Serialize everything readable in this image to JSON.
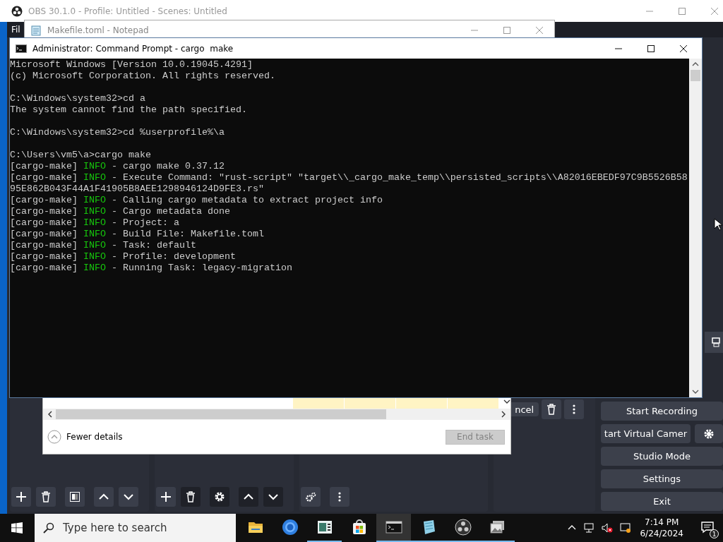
{
  "obs": {
    "title": "OBS 30.1.0 - Profile: Untitled - Scenes: Untitled",
    "menu": [
      "Fil"
    ],
    "dock_button": "ncel",
    "controls": [
      {
        "label": "Start Recording",
        "settings": false
      },
      {
        "label": "tart Virtual Camer",
        "settings": true
      },
      {
        "label": "Studio Mode",
        "settings": false
      },
      {
        "label": "Settings",
        "settings": false
      },
      {
        "label": "Exit",
        "settings": false
      }
    ]
  },
  "notepad": {
    "title": "Makefile.toml - Notepad"
  },
  "task_manager": {
    "toggle": "Fewer details",
    "end_task": {
      "label": "End task",
      "disabled": true
    }
  },
  "cmd": {
    "title": "Administrator: Command Prompt - cargo  make",
    "lines": [
      {
        "kind": "text",
        "text": "Microsoft Windows [Version 10.0.19045.4291]"
      },
      {
        "kind": "text",
        "text": "(c) Microsoft Corporation. All rights reserved."
      },
      {
        "kind": "blank"
      },
      {
        "kind": "text",
        "text": "C:\\Windows\\system32>cd a"
      },
      {
        "kind": "text",
        "text": "The system cannot find the path specified."
      },
      {
        "kind": "blank"
      },
      {
        "kind": "text",
        "text": "C:\\Windows\\system32>cd %userprofile%\\a"
      },
      {
        "kind": "blank"
      },
      {
        "kind": "text",
        "text": "C:\\Users\\vm5\\a>cargo make"
      },
      {
        "kind": "log",
        "source": "[cargo-make]",
        "level": "INFO",
        "message": "- cargo make 0.37.12"
      },
      {
        "kind": "log",
        "source": "[cargo-make]",
        "level": "INFO",
        "message": "- Execute Command: \"rust-script\" \"target\\\\_cargo_make_temp\\\\persisted_scripts\\\\A82016EBEDF97C9B5526B58"
      },
      {
        "kind": "text",
        "text": "95E862B043F44A1F41905B8AEE1298946124D9FE3.rs\""
      },
      {
        "kind": "log",
        "source": "[cargo-make]",
        "level": "INFO",
        "message": "- Calling cargo metadata to extract project info"
      },
      {
        "kind": "log",
        "source": "[cargo-make]",
        "level": "INFO",
        "message": "- Cargo metadata done"
      },
      {
        "kind": "log",
        "source": "[cargo-make]",
        "level": "INFO",
        "message": "- Project: a"
      },
      {
        "kind": "log",
        "source": "[cargo-make]",
        "level": "INFO",
        "message": "- Build File: Makefile.toml"
      },
      {
        "kind": "log",
        "source": "[cargo-make]",
        "level": "INFO",
        "message": "- Task: default"
      },
      {
        "kind": "log",
        "source": "[cargo-make]",
        "level": "INFO",
        "message": "- Profile: development"
      },
      {
        "kind": "log",
        "source": "[cargo-make]",
        "level": "INFO",
        "message": "- Running Task: legacy-migration"
      }
    ]
  },
  "taskbar": {
    "search_placeholder": "Type here to search",
    "apps": [
      {
        "kind": "folder",
        "selected": false,
        "running": false
      },
      {
        "kind": "browser",
        "selected": false,
        "running": false
      },
      {
        "kind": "monitor",
        "selected": false,
        "running": true
      },
      {
        "kind": "store",
        "selected": false,
        "running": false
      },
      {
        "kind": "terminal",
        "selected": true,
        "running": true
      },
      {
        "kind": "notepad",
        "selected": false,
        "running": true
      },
      {
        "kind": "obs",
        "selected": false,
        "running": true
      },
      {
        "kind": "photos",
        "selected": false,
        "running": true
      }
    ],
    "clock": {
      "time": "7:14 PM",
      "date": "6/24/2024"
    },
    "notifications": "1"
  }
}
